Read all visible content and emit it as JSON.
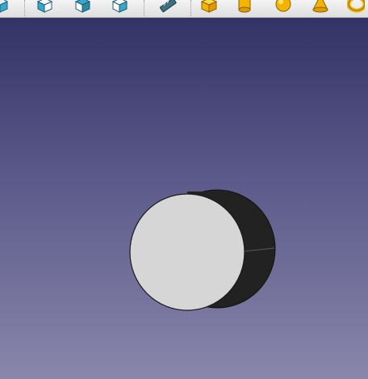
{
  "window": {
    "title": ""
  },
  "toolbar": {
    "buttons": [
      {
        "id": "view-left",
        "icon": "view-left-icon"
      },
      {
        "id": "view-front",
        "icon": "view-front-icon"
      },
      {
        "id": "view-top",
        "icon": "view-top-icon"
      },
      {
        "id": "view-right",
        "icon": "view-right-icon"
      },
      {
        "id": "measure",
        "icon": "measure-icon"
      },
      {
        "id": "box",
        "icon": "box-icon"
      },
      {
        "id": "cylinder",
        "icon": "cylinder-icon"
      },
      {
        "id": "sphere",
        "icon": "sphere-icon"
      },
      {
        "id": "cone",
        "icon": "cone-icon"
      },
      {
        "id": "torus",
        "icon": "torus-icon"
      }
    ],
    "colors": {
      "view_icon": "#3aa6c8",
      "primitive_icon": "#f2b400"
    }
  },
  "viewport": {
    "background_top": "#333366",
    "background_bottom": "#8886aa",
    "object": {
      "type": "cylinder",
      "face_color": "#d6d6d6",
      "side_color": "#222222"
    }
  }
}
